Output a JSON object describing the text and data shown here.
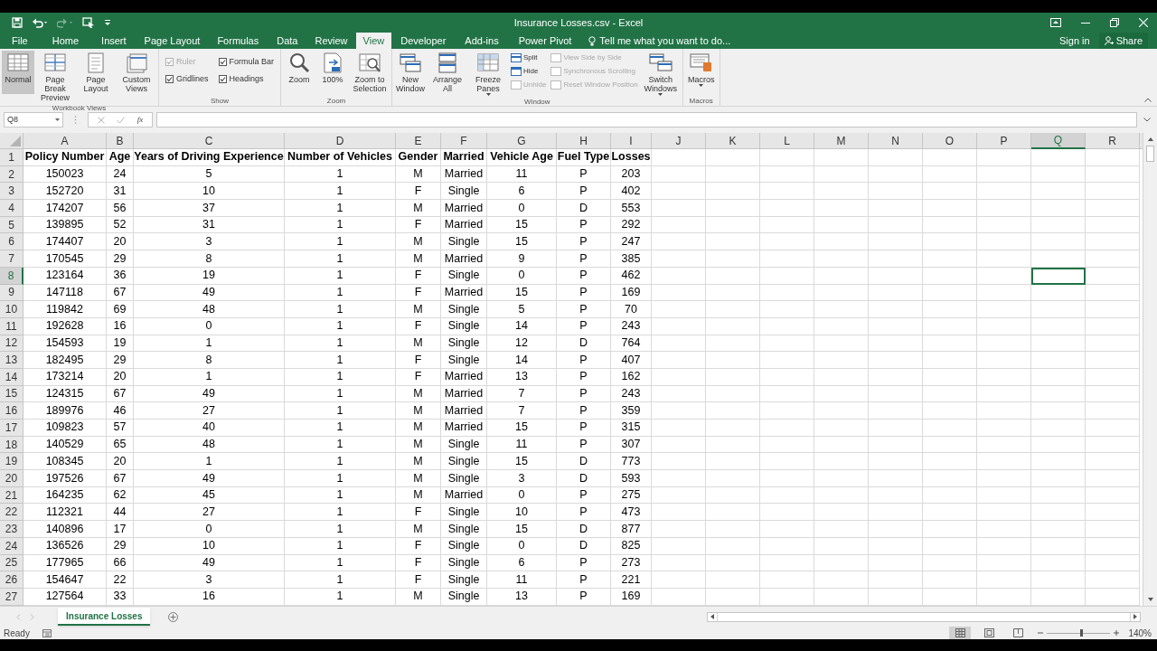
{
  "window": {
    "title": "Insurance Losses.csv - Excel"
  },
  "ribbon_tabs": [
    {
      "label": "File",
      "selected": false
    },
    {
      "label": "Home",
      "selected": false
    },
    {
      "label": "Insert",
      "selected": false
    },
    {
      "label": "Page Layout",
      "selected": false
    },
    {
      "label": "Formulas",
      "selected": false
    },
    {
      "label": "Data",
      "selected": false
    },
    {
      "label": "Review",
      "selected": false
    },
    {
      "label": "View",
      "selected": true
    },
    {
      "label": "Developer",
      "selected": false
    },
    {
      "label": "Add-ins",
      "selected": false
    },
    {
      "label": "Power Pivot",
      "selected": false
    }
  ],
  "tell_me": {
    "placeholder": "Tell me what you want to do..."
  },
  "sign_in": "Sign in",
  "share": "Share",
  "ribbon_groups": [
    {
      "label": "Workbook Views",
      "items": [
        {
          "kind": "large",
          "label": "Normal",
          "selected": true
        },
        {
          "kind": "large",
          "label": "Page Break Preview",
          "selected": false
        },
        {
          "kind": "large",
          "label": "Page Layout",
          "selected": false
        },
        {
          "kind": "large",
          "label": "Custom Views",
          "selected": false
        }
      ]
    },
    {
      "label": "Show",
      "items": [
        {
          "kind": "checks",
          "items": [
            {
              "label": "Ruler",
              "checked": true,
              "disabled": true
            },
            {
              "label": "Gridlines",
              "checked": true,
              "disabled": false
            }
          ]
        },
        {
          "kind": "checks",
          "items": [
            {
              "label": "Formula Bar",
              "checked": true,
              "disabled": false
            },
            {
              "label": "Headings",
              "checked": true,
              "disabled": false
            }
          ]
        }
      ]
    },
    {
      "label": "Zoom",
      "items": [
        {
          "kind": "large",
          "label": "Zoom",
          "selected": false
        },
        {
          "kind": "large",
          "label": "100%",
          "selected": false
        },
        {
          "kind": "large",
          "label": "Zoom to Selection",
          "selected": false
        }
      ]
    },
    {
      "label": "Window",
      "items": [
        {
          "kind": "large",
          "label": "New Window",
          "selected": false
        },
        {
          "kind": "large",
          "label": "Arrange All",
          "selected": false
        },
        {
          "kind": "large",
          "label": "Freeze Panes",
          "selected": false,
          "dropdown": true
        },
        {
          "kind": "small",
          "items": [
            {
              "label": "Split",
              "disabled": false
            },
            {
              "label": "Hide",
              "disabled": false
            },
            {
              "label": "Unhide",
              "disabled": true
            }
          ]
        },
        {
          "kind": "small",
          "items": [
            {
              "label": "View Side by Side",
              "disabled": true
            },
            {
              "label": "Synchronous Scrolling",
              "disabled": true
            },
            {
              "label": "Reset Window Position",
              "disabled": true
            }
          ]
        },
        {
          "kind": "large",
          "label": "Switch Windows",
          "selected": false,
          "dropdown": true
        }
      ]
    },
    {
      "label": "Macros",
      "items": [
        {
          "kind": "large",
          "label": "Macros",
          "selected": false,
          "dropdown": true
        }
      ]
    }
  ],
  "formula_bar": {
    "name_box": "Q8",
    "fx": "fx"
  },
  "grid": {
    "columns": [
      {
        "label": "A",
        "selected": false
      },
      {
        "label": "B",
        "selected": false
      },
      {
        "label": "C",
        "selected": false
      },
      {
        "label": "D",
        "selected": false
      },
      {
        "label": "E",
        "selected": false
      },
      {
        "label": "F",
        "selected": false
      },
      {
        "label": "G",
        "selected": false
      },
      {
        "label": "H",
        "selected": false
      },
      {
        "label": "I",
        "selected": false
      },
      {
        "label": "J",
        "selected": false
      },
      {
        "label": "K",
        "selected": false
      },
      {
        "label": "L",
        "selected": false
      },
      {
        "label": "M",
        "selected": false
      },
      {
        "label": "N",
        "selected": false
      },
      {
        "label": "O",
        "selected": false
      },
      {
        "label": "P",
        "selected": false
      },
      {
        "label": "Q",
        "selected": true
      },
      {
        "label": "R",
        "selected": false
      }
    ],
    "rows": [
      {
        "number": "1",
        "selected": false,
        "cells": [
          "Policy Number",
          "Age",
          "Years of Driving Experience",
          "Number of Vehicles",
          "Gender",
          "Married",
          "Vehicle Age",
          "Fuel Type",
          "Losses"
        ]
      },
      {
        "number": "2",
        "selected": false,
        "cells": [
          "150023",
          "24",
          "5",
          "1",
          "M",
          "Married",
          "11",
          "P",
          "203"
        ]
      },
      {
        "number": "3",
        "selected": false,
        "cells": [
          "152720",
          "31",
          "10",
          "1",
          "F",
          "Single",
          "6",
          "P",
          "402"
        ]
      },
      {
        "number": "4",
        "selected": false,
        "cells": [
          "174207",
          "56",
          "37",
          "1",
          "M",
          "Married",
          "0",
          "D",
          "553"
        ]
      },
      {
        "number": "5",
        "selected": false,
        "cells": [
          "139895",
          "52",
          "31",
          "1",
          "F",
          "Married",
          "15",
          "P",
          "292"
        ]
      },
      {
        "number": "6",
        "selected": false,
        "cells": [
          "174407",
          "20",
          "3",
          "1",
          "M",
          "Single",
          "15",
          "P",
          "247"
        ]
      },
      {
        "number": "7",
        "selected": false,
        "cells": [
          "170545",
          "29",
          "8",
          "1",
          "M",
          "Married",
          "9",
          "P",
          "385"
        ]
      },
      {
        "number": "8",
        "selected": true,
        "cells": [
          "123164",
          "36",
          "19",
          "1",
          "F",
          "Single",
          "0",
          "P",
          "462"
        ]
      },
      {
        "number": "9",
        "selected": false,
        "cells": [
          "147118",
          "67",
          "49",
          "1",
          "F",
          "Married",
          "15",
          "P",
          "169"
        ]
      },
      {
        "number": "10",
        "selected": false,
        "cells": [
          "119842",
          "69",
          "48",
          "1",
          "M",
          "Single",
          "5",
          "P",
          "70"
        ]
      },
      {
        "number": "11",
        "selected": false,
        "cells": [
          "192628",
          "16",
          "0",
          "1",
          "F",
          "Single",
          "14",
          "P",
          "243"
        ]
      },
      {
        "number": "12",
        "selected": false,
        "cells": [
          "154593",
          "19",
          "1",
          "1",
          "M",
          "Single",
          "12",
          "D",
          "764"
        ]
      },
      {
        "number": "13",
        "selected": false,
        "cells": [
          "182495",
          "29",
          "8",
          "1",
          "F",
          "Single",
          "14",
          "P",
          "407"
        ]
      },
      {
        "number": "14",
        "selected": false,
        "cells": [
          "173214",
          "20",
          "1",
          "1",
          "F",
          "Married",
          "13",
          "P",
          "162"
        ]
      },
      {
        "number": "15",
        "selected": false,
        "cells": [
          "124315",
          "67",
          "49",
          "1",
          "M",
          "Married",
          "7",
          "P",
          "243"
        ]
      },
      {
        "number": "16",
        "selected": false,
        "cells": [
          "189976",
          "46",
          "27",
          "1",
          "M",
          "Married",
          "7",
          "P",
          "359"
        ]
      },
      {
        "number": "17",
        "selected": false,
        "cells": [
          "109823",
          "57",
          "40",
          "1",
          "M",
          "Married",
          "15",
          "P",
          "315"
        ]
      },
      {
        "number": "18",
        "selected": false,
        "cells": [
          "140529",
          "65",
          "48",
          "1",
          "M",
          "Single",
          "11",
          "P",
          "307"
        ]
      },
      {
        "number": "19",
        "selected": false,
        "cells": [
          "108345",
          "20",
          "1",
          "1",
          "M",
          "Single",
          "15",
          "D",
          "773"
        ]
      },
      {
        "number": "20",
        "selected": false,
        "cells": [
          "197526",
          "67",
          "49",
          "1",
          "M",
          "Single",
          "3",
          "D",
          "593"
        ]
      },
      {
        "number": "21",
        "selected": false,
        "cells": [
          "164235",
          "62",
          "45",
          "1",
          "M",
          "Married",
          "0",
          "P",
          "275"
        ]
      },
      {
        "number": "22",
        "selected": false,
        "cells": [
          "112321",
          "44",
          "27",
          "1",
          "F",
          "Single",
          "10",
          "P",
          "473"
        ]
      },
      {
        "number": "23",
        "selected": false,
        "cells": [
          "140896",
          "17",
          "0",
          "1",
          "M",
          "Single",
          "15",
          "D",
          "877"
        ]
      },
      {
        "number": "24",
        "selected": false,
        "cells": [
          "136526",
          "29",
          "10",
          "1",
          "F",
          "Single",
          "0",
          "D",
          "825"
        ]
      },
      {
        "number": "25",
        "selected": false,
        "cells": [
          "177965",
          "66",
          "49",
          "1",
          "F",
          "Single",
          "6",
          "P",
          "273"
        ]
      },
      {
        "number": "26",
        "selected": false,
        "cells": [
          "154647",
          "22",
          "3",
          "1",
          "F",
          "Single",
          "11",
          "P",
          "221"
        ]
      },
      {
        "number": "27",
        "selected": false,
        "cells": [
          "127564",
          "33",
          "16",
          "1",
          "M",
          "Single",
          "13",
          "P",
          "169"
        ]
      }
    ]
  },
  "sheet_tabs": [
    {
      "label": "Insurance Losses",
      "selected": true
    }
  ],
  "status_bar": {
    "status": "Ready",
    "views": [
      {
        "selected": true
      },
      {
        "selected": false
      },
      {
        "selected": false
      }
    ],
    "zoom": {
      "level": 0.54,
      "label": "140%"
    }
  }
}
